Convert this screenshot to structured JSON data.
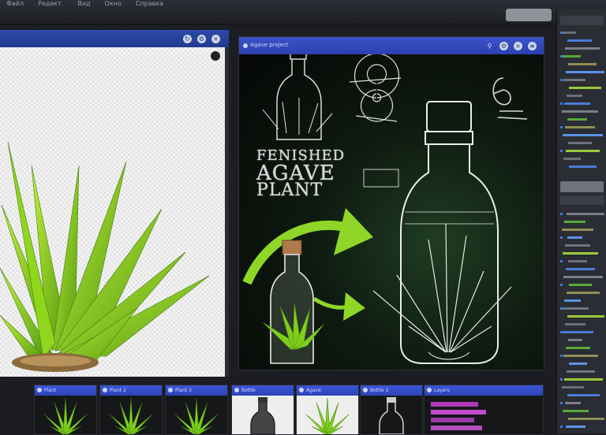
{
  "topbar": {
    "menu": [
      "Файл",
      "Редакт.",
      "Вид",
      "Окно",
      "Справка"
    ],
    "action_label": ""
  },
  "left_panel": {
    "header_icons": [
      "refresh-icon",
      "settings-icon",
      "close-icon"
    ]
  },
  "main_panel": {
    "header_title": "Agave project",
    "header_icons": [
      "link-icon",
      "settings-icon",
      "close-icon",
      "menu-icon"
    ],
    "title_lines": [
      "FENISHED",
      "AGAVE",
      "PLANT"
    ]
  },
  "thumbnails": [
    {
      "label": "Plant",
      "style": "dark-plant"
    },
    {
      "label": "Plant 2",
      "style": "dark-plant"
    },
    {
      "label": "Plant 3",
      "style": "dark-plant"
    },
    {
      "label": "Bottle",
      "style": "light-bottle"
    },
    {
      "label": "Agave",
      "style": "light-plant"
    },
    {
      "label": "Bottle 2",
      "style": "dark-bottle"
    },
    {
      "label": "Layers",
      "style": "code"
    }
  ],
  "colors": {
    "accent": "#2f47c2",
    "leaf_green": "#7fcf1a",
    "arrow_green": "#8fd628",
    "sketch_white": "#e8e8e8"
  }
}
